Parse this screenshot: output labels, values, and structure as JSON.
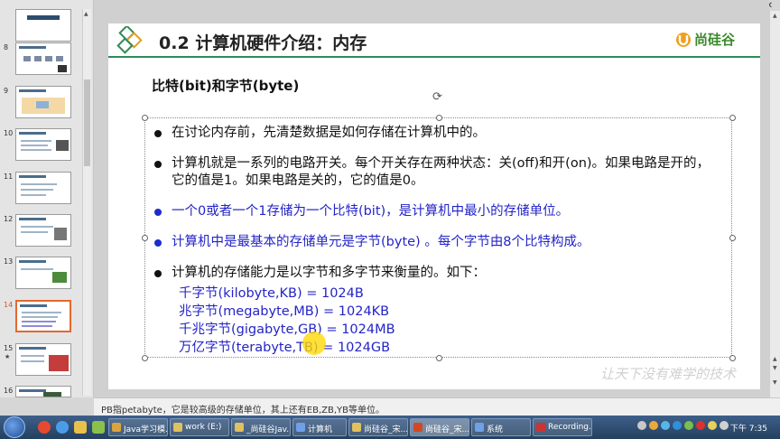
{
  "window": {
    "minimize_glyph": "—",
    "restore_glyph": "❐",
    "close_glyph": "✕"
  },
  "slides_panel": {
    "thumbnails": [
      {
        "number": "8"
      },
      {
        "number": "9"
      },
      {
        "number": "10"
      },
      {
        "number": "11"
      },
      {
        "number": "12"
      },
      {
        "number": "13"
      },
      {
        "number": "14"
      },
      {
        "number": "15",
        "marker": "★"
      },
      {
        "number": "16"
      }
    ],
    "active_number": "14"
  },
  "slide": {
    "title": "0.2 计算机硬件介绍：内存",
    "brand_name": "尚硅谷",
    "subheading": "比特(bit)和字节(byte)",
    "bullets": [
      "在讨论内存前，先清楚数据是如何存储在计算机中的。",
      "计算机就是一系列的电路开关。每个开关存在两种状态：关(off)和开(on)。如果电路是开的，它的值是1。如果电路是关的，它的值是0。",
      "一个0或者一个1存储为一个比特(bit)，是计算机中最小的存储单位。",
      "计算机中是最基本的存储单元是字节(byte) 。每个字节由8个比特构成。",
      "计算机的存储能力是以字节和多字节来衡量的。如下："
    ],
    "units": [
      "千字节(kilobyte,KB)  = 1024B",
      "兆字节(megabyte,MB) = 1024KB",
      "千兆字节(gigabyte,GB) = 1024MB",
      "万亿字节(terabyte,TB) = 1024GB"
    ],
    "watermark": "让天下没有难学的技术",
    "colors": {
      "accent_green": "#2e8b57",
      "blue_text": "#2424c8",
      "brand_green": "#3a8a2c"
    }
  },
  "notes": "PB指petabyte，它是较高级的存储单位，其上还有EB,ZB,YB等单位。",
  "taskbar": {
    "items": [
      {
        "label": "Java学习模...",
        "color": "#d9a441"
      },
      {
        "label": "work (E:)",
        "color": "#e0c060"
      },
      {
        "label": "_尚硅谷Jav...",
        "color": "#e0c060"
      },
      {
        "label": "计算机",
        "color": "#6fa0e8"
      },
      {
        "label": "尚硅谷_宋...",
        "color": "#e0c060"
      },
      {
        "label": "尚硅谷_宋...",
        "color": "#d24726",
        "active": true
      },
      {
        "label": "系统",
        "color": "#6fa0e8"
      },
      {
        "label": "Recording...",
        "color": "#cc3333"
      }
    ],
    "clock": "下午 7:35"
  }
}
